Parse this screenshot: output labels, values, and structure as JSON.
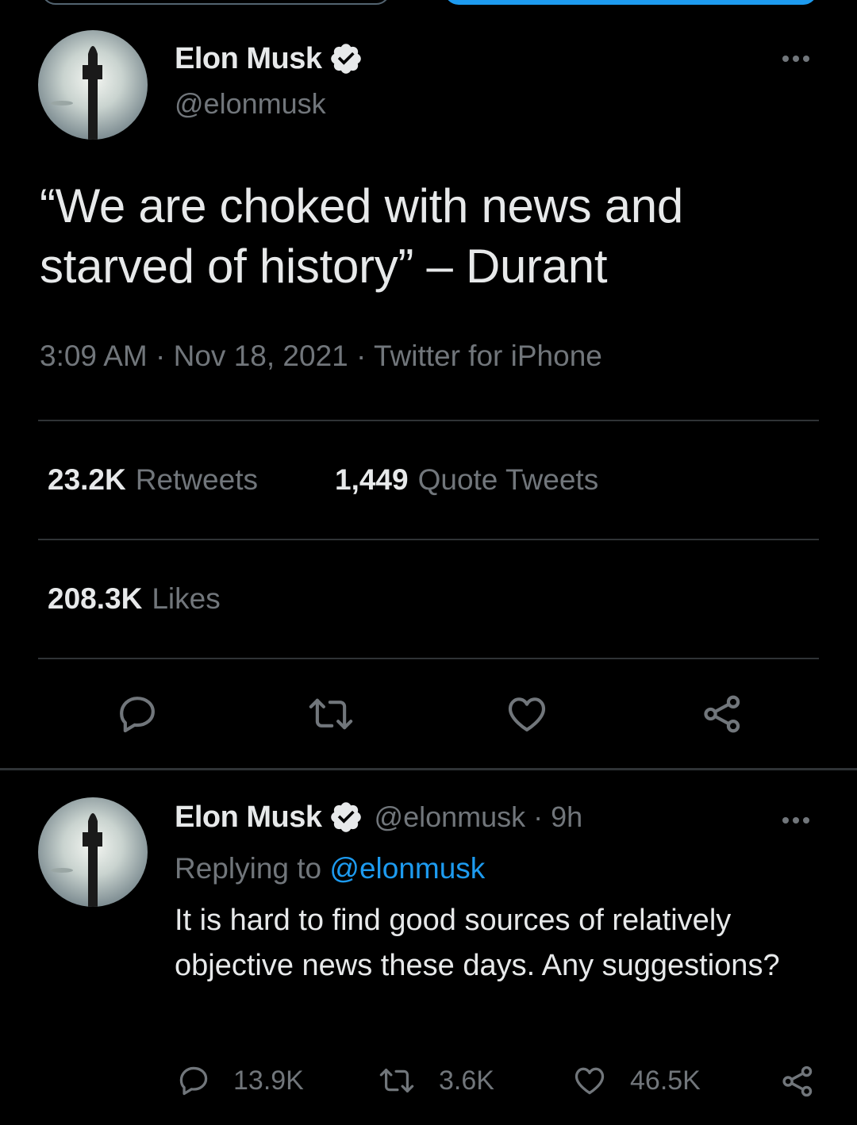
{
  "main_tweet": {
    "author_name": "Elon Musk",
    "author_handle": "@elonmusk",
    "text": "“We are choked with news and starved of history” – Durant",
    "timestamp": "3:09 AM · Nov 18, 2021 · Twitter for iPhone",
    "retweets_count": "23.2K",
    "retweets_label": "Retweets",
    "quote_count": "1,449",
    "quote_label": "Quote Tweets",
    "likes_count": "208.3K",
    "likes_label": "Likes"
  },
  "reply": {
    "author_name": "Elon Musk",
    "author_handle": "@elonmusk",
    "separator": "·",
    "time_ago": "9h",
    "replying_label": "Replying to",
    "replying_handle": "@elonmusk",
    "text": "It is hard to find good sources of relatively objective news these days. Any suggestions?",
    "reply_count": "13.9K",
    "retweet_count": "3.6K",
    "like_count": "46.5K"
  },
  "colors": {
    "background": "#000000",
    "text_primary": "#e7e9ea",
    "text_secondary": "#71767b",
    "accent": "#1d9bf0",
    "divider": "#2f3336"
  },
  "icons": [
    "verified-badge-icon",
    "more-options-icon",
    "reply-icon",
    "retweet-icon",
    "like-icon",
    "share-icon"
  ]
}
